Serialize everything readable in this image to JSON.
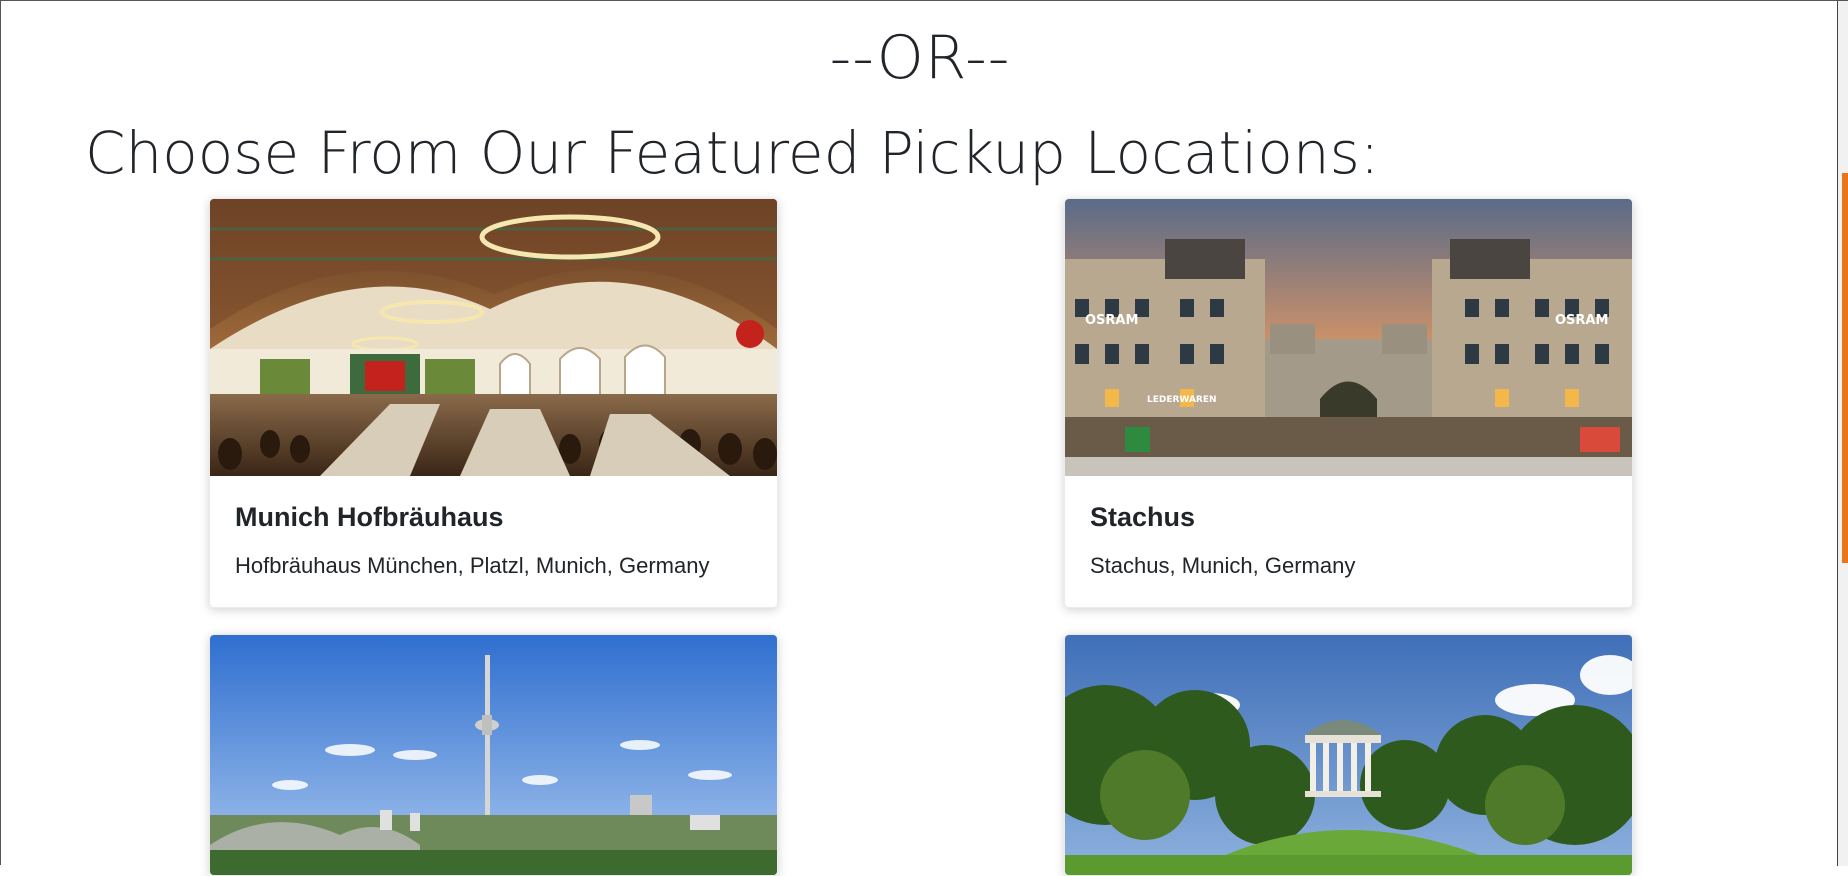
{
  "divider": {
    "text": "--OR--"
  },
  "section": {
    "title": "Choose From Our Featured Pickup Locations:"
  },
  "locations": [
    {
      "title": "Munich Hofbräuhaus",
      "address": "Hofbräuhaus München, Platzl, Munich, Germany",
      "image": "beer-hall-interior"
    },
    {
      "title": "Stachus",
      "address": "Stachus, Munich, Germany",
      "image": "karlstor-square"
    },
    {
      "title": "",
      "address": "",
      "image": "olympic-park-tower"
    },
    {
      "title": "",
      "address": "",
      "image": "english-garden-monopteros"
    }
  ],
  "photo_signage": {
    "left_sign": "OSRAM",
    "right_sign": "OSRAM",
    "store_sign": "LEDERWAREN"
  },
  "colors": {
    "scroll_thumb": "#e8761a",
    "text": "#212529"
  }
}
